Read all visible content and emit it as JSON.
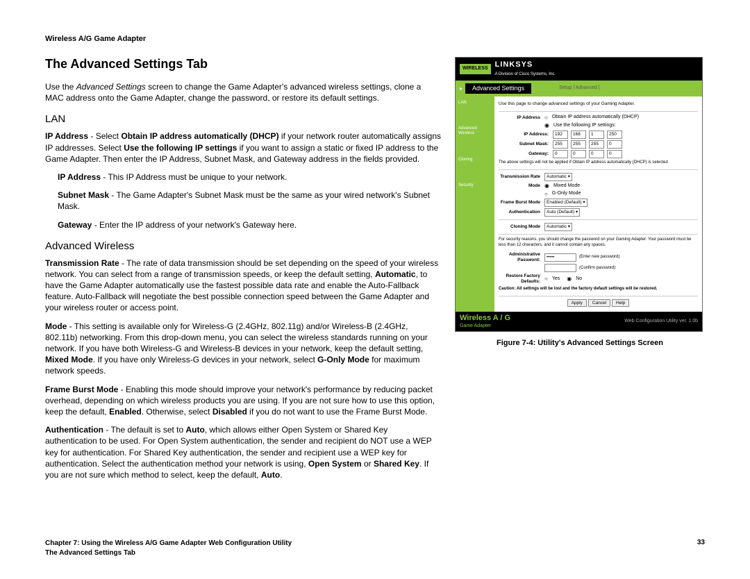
{
  "header": "Wireless A/G Game Adapter",
  "title": "The Advanced Settings Tab",
  "intro_pre": "Use the ",
  "intro_em": "Advanced Settings",
  "intro_post": " screen to change the Game Adapter's advanced wireless settings, clone a MAC address onto the Game Adapter, change the password, or restore its default settings.",
  "lan_heading": "LAN",
  "lan_ip_p1a": "IP Address",
  "lan_ip_p1b": " - Select ",
  "lan_ip_p1c": "Obtain IP address automatically (DHCP)",
  "lan_ip_p1d": " if your network router automatically assigns IP addresses. Select ",
  "lan_ip_p1e": "Use the following IP settings",
  "lan_ip_p1f": " if you want to assign a static or fixed IP address to the Game Adapter. Then enter the IP Address, Subnet Mask, and Gateway address in the fields provided.",
  "ip_sub1a": "IP Address",
  "ip_sub1b": " - This IP Address must be unique to your network.",
  "ip_sub2a": "Subnet Mask",
  "ip_sub2b": " - The Game Adapter's Subnet Mask must be the same as your wired network's Subnet Mask.",
  "ip_sub3a": "Gateway",
  "ip_sub3b": " - Enter the IP address of your network's Gateway here.",
  "aw_heading": "Advanced Wireless",
  "aw_tx_a": "Transmission Rate",
  "aw_tx_b": " - The rate of data transmission should be set depending on the speed of your wireless network. You can select from a range of transmission speeds, or keep the default setting, ",
  "aw_tx_c": "Automatic",
  "aw_tx_d": ", to have the Game Adapter automatically use the fastest possible data rate and enable the Auto-Fallback feature. Auto-Fallback will negotiate the best possible connection speed between the Game Adapter and your wireless router or access point.",
  "aw_mode_a": "Mode",
  "aw_mode_b": " - This setting is available only for Wireless-G (2.4GHz, 802.11g) and/or Wireless-B (2.4GHz, 802.11b) networking. From this drop-down menu, you can select the wireless standards running on your network. If you have both Wireless-G and Wireless-B devices in your network, keep the default setting, ",
  "aw_mode_c": "Mixed Mode",
  "aw_mode_d": ". If you have only Wireless-G devices in your network, select ",
  "aw_mode_e": "G-Only Mode",
  "aw_mode_f": " for maximum network speeds.",
  "aw_fb_a": "Frame Burst Mode",
  "aw_fb_b": " - Enabling this mode should improve your network's performance by reducing packet overhead, depending on which wireless products you are using. If you are not sure how to use this option, keep the default, ",
  "aw_fb_c": "Enabled",
  "aw_fb_d": ". Otherwise, select ",
  "aw_fb_e": "Disabled",
  "aw_fb_f": " if you do not want to use the Frame Burst Mode.",
  "aw_auth_a": "Authentication",
  "aw_auth_b": " - The default is set to ",
  "aw_auth_c": "Auto",
  "aw_auth_d": ", which allows either Open System or Shared Key authentication to be used. For Open System authentication, the sender and recipient do NOT use a WEP key for authentication. For Shared Key authentication, the sender and recipient use a WEP key for authentication. Select the authentication method your network is using, ",
  "aw_auth_e": "Open System",
  "aw_auth_f": " or ",
  "aw_auth_g": "Shared Key",
  "aw_auth_h": ". If you are not sure which method to select, keep the default, ",
  "aw_auth_i": "Auto",
  "aw_auth_j": ".",
  "footer_chapter": "Chapter 7: Using the Wireless A/G Game Adapter Web Configuration Utility",
  "footer_section": "The Advanced Settings Tab",
  "footer_page": "33",
  "shot": {
    "wireless": "WIRELESS",
    "brand": "LINKSYS",
    "brand_sub": "A Division of Cisco Systems, Inc.",
    "nav_title": "Advanced Settings",
    "nav_links": "Setup | Advanced | ",
    "note": "Use this page to change advanced settings of your Gaming Adapter.",
    "sidebar": {
      "lan": "LAN",
      "aw": "Advanced Wireless",
      "cloning": "Cloning",
      "security": "Security"
    },
    "labels": {
      "ip": "IP Address",
      "dhcp": "Obtain IP address automatically (DHCP)",
      "static": "Use the following IP settings:",
      "ipaddr": "IP Address:",
      "subnet": "Subnet Mask:",
      "gateway": "Gateway:",
      "ipnote": "The above settings will not be applied if Obtain IP address automatically (DHCP) is selected",
      "txrate": "Transmission Rate",
      "mode": "Mode",
      "mixed": "Mixed Mode",
      "gonly": "G-Only Mode",
      "fbm": "Frame Burst Mode",
      "auth": "Authentication",
      "cloning": "Cloning Mode",
      "secnote": "For security reasons, you should change the password on your Gaming Adapter. Your password must be less than 12 characters, and it cannot contain any spaces.",
      "adminpw": "Administrative Password:",
      "enter": "(Enter new password)",
      "confirm": "(Confirm password)",
      "restore": "Restore Factory Defaults:",
      "yes": "Yes",
      "no": "No",
      "caution": "Caution: All settings will be lost and the factory default settings will be restored.",
      "apply": "Apply",
      "cancel": "Cancel",
      "help": "Help"
    },
    "vals": {
      "ip": [
        "192",
        "168",
        "1",
        "250"
      ],
      "sm": [
        "255",
        "255",
        "255",
        "0"
      ],
      "gw": [
        "0",
        "0",
        "0",
        "0"
      ],
      "txrate": "Automatic",
      "fbm": "Enabled (Default)",
      "auth": "Auto (Default)",
      "cloning": "Automatic"
    },
    "footer_left": "Wireless A / G",
    "footer_ga": "Game Adapter",
    "footer_right": "Web Configuration Utility  ver. 1.0b"
  },
  "caption": "Figure 7-4: Utility's Advanced Settings Screen"
}
